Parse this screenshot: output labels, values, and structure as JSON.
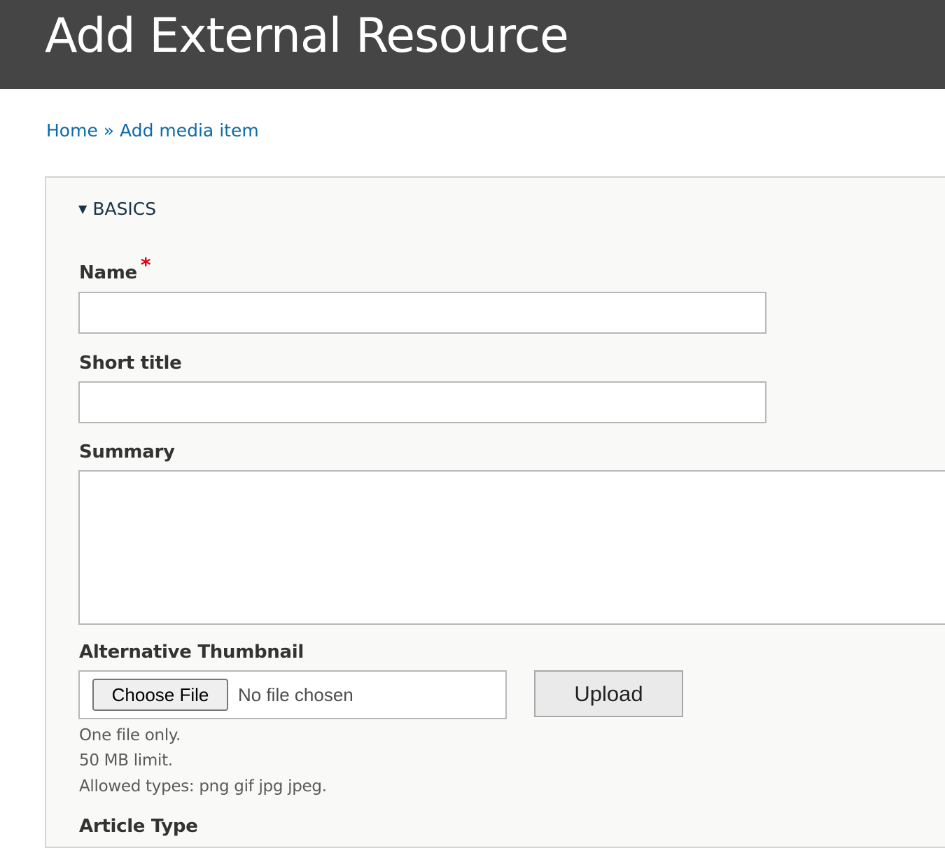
{
  "header": {
    "title": "Add External Resource"
  },
  "breadcrumb": {
    "items": [
      "Home",
      "Add media item"
    ],
    "separator": "»"
  },
  "form": {
    "section": {
      "label": "BASICS",
      "expanded": true
    },
    "fields": {
      "name": {
        "label": "Name",
        "required_marker": "*",
        "value": ""
      },
      "short_title": {
        "label": "Short title",
        "value": ""
      },
      "summary": {
        "label": "Summary",
        "value": ""
      },
      "alternative_thumbnail": {
        "label": "Alternative Thumbnail",
        "choose_button_label": "Choose File",
        "file_status": "No file chosen",
        "upload_button_label": "Upload",
        "descriptions": [
          "One file only.",
          "50 MB limit.",
          "Allowed types: png gif jpg jpeg."
        ]
      },
      "article_type": {
        "label": "Article Type"
      }
    }
  },
  "colors": {
    "header_bg": "#454545",
    "link": "#0d6aa8",
    "required": "#e2000f",
    "panel_bg": "#f9f9f8"
  }
}
